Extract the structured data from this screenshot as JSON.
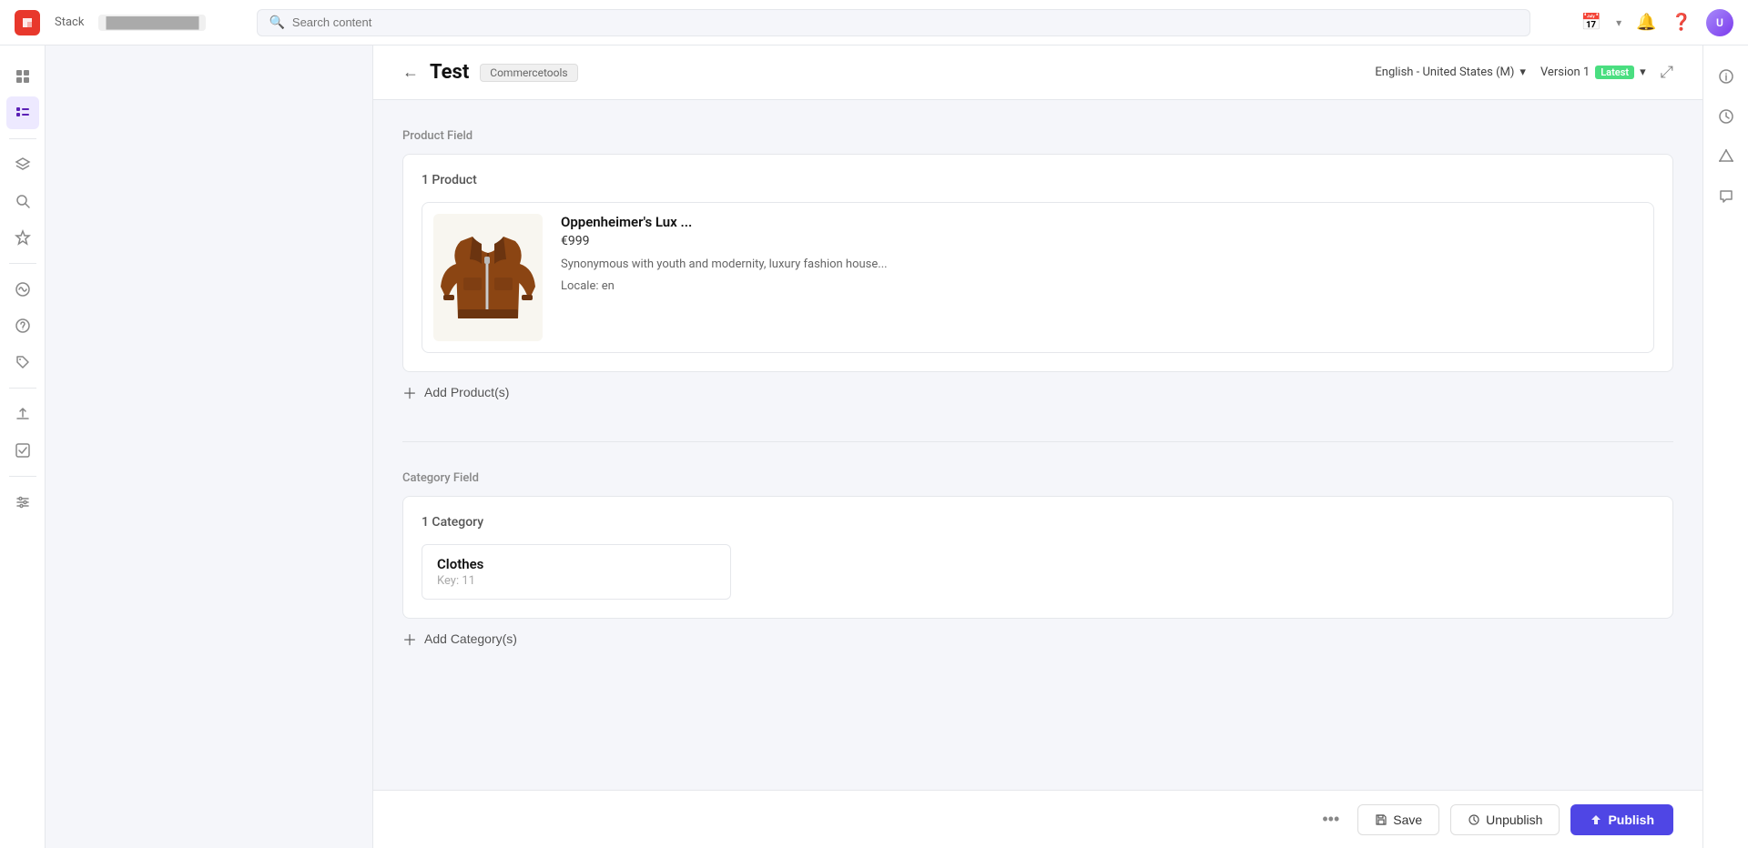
{
  "app": {
    "name": "Stack",
    "breadcrumb": "████████████"
  },
  "topnav": {
    "search_placeholder": "Search content",
    "avatar_initials": "U"
  },
  "content_header": {
    "back_label": "←",
    "title": "Test",
    "badge": "Commercetools",
    "language": "English - United States (M)",
    "version_label": "Version 1",
    "latest_badge": "Latest"
  },
  "product_field": {
    "label": "Product Field",
    "count": "1 Product",
    "product": {
      "name": "Oppenheimer's Lux ...",
      "price": "€999",
      "description": "Synonymous with youth and modernity, luxury fashion house...",
      "locale": "Locale: en"
    },
    "add_label": "Add Product(s)"
  },
  "category_field": {
    "label": "Category Field",
    "count": "1 Category",
    "category": {
      "name": "Clothes",
      "key": "Key: 11"
    },
    "add_label": "Add Category(s)"
  },
  "toolbar": {
    "more_label": "•••",
    "save_label": "Save",
    "unpublish_label": "Unpublish",
    "publish_label": "Publish"
  },
  "sidebar": {
    "icons": [
      "⊞",
      "☰",
      "◎",
      "✱",
      "◎",
      "⊙"
    ],
    "active_index": 1
  },
  "right_rail": {
    "icons": [
      "ℹ",
      "⏱",
      "⬡",
      "✉"
    ]
  }
}
